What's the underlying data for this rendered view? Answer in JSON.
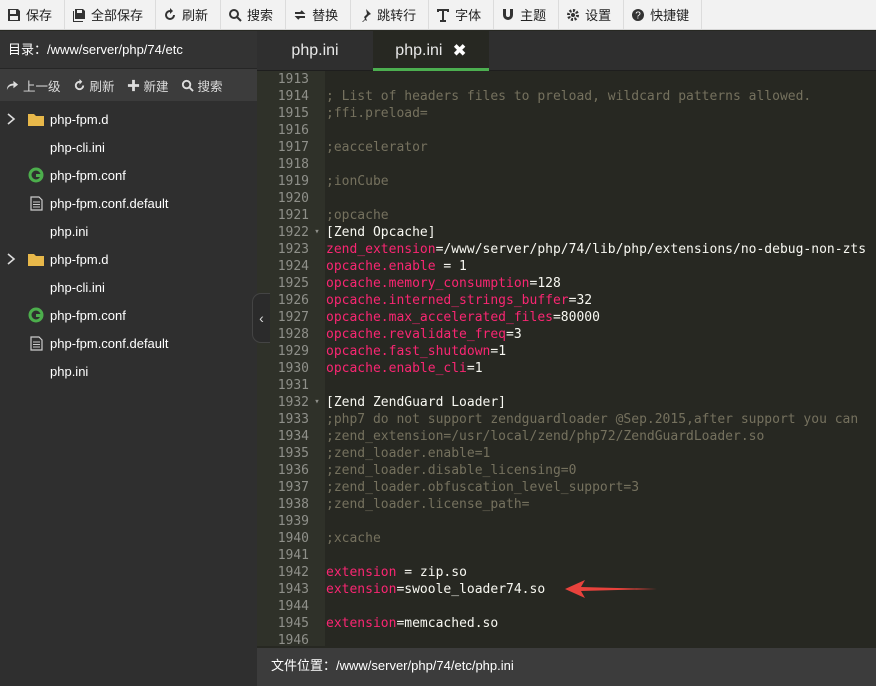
{
  "toolbar": {
    "buttons": [
      {
        "label": "保存",
        "icon": "save-icon"
      },
      {
        "label": "全部保存",
        "icon": "save-all-icon"
      },
      {
        "label": "刷新",
        "icon": "refresh-icon"
      },
      {
        "label": "搜索",
        "icon": "search-icon"
      },
      {
        "label": "替换",
        "icon": "replace-icon"
      },
      {
        "label": "跳转行",
        "icon": "pin-icon"
      },
      {
        "label": "字体",
        "icon": "font-icon"
      },
      {
        "label": "主题",
        "icon": "magnet-icon"
      },
      {
        "label": "设置",
        "icon": "gear-icon"
      },
      {
        "label": "快捷键",
        "icon": "help-icon"
      }
    ]
  },
  "sidebar": {
    "directory": "目录：/www/server/php/74/etc",
    "actions": [
      {
        "label": "上一级",
        "icon": "share-icon"
      },
      {
        "label": "刷新",
        "icon": "refresh-icon"
      },
      {
        "label": "新建",
        "icon": "plus-icon"
      },
      {
        "label": "搜索",
        "icon": "search-icon"
      }
    ],
    "files": [
      {
        "name": "php-fpm.d",
        "type": "folder"
      },
      {
        "name": "php-cli.ini",
        "type": "file"
      },
      {
        "name": "php-fpm.conf",
        "type": "conf"
      },
      {
        "name": "php-fpm.conf.default",
        "type": "doc"
      },
      {
        "name": "php.ini",
        "type": "file"
      },
      {
        "name": "php-fpm.d",
        "type": "folder"
      },
      {
        "name": "php-cli.ini",
        "type": "file"
      },
      {
        "name": "php-fpm.conf",
        "type": "conf"
      },
      {
        "name": "php-fpm.conf.default",
        "type": "doc"
      },
      {
        "name": "php.ini",
        "type": "file"
      }
    ]
  },
  "tabs": [
    {
      "label": "php.ini",
      "active": false
    },
    {
      "label": "php.ini",
      "active": true,
      "close": "✖"
    }
  ],
  "code_lines": [
    {
      "n": "1913",
      "fold": "",
      "parts": []
    },
    {
      "n": "1914",
      "fold": "",
      "parts": [
        {
          "t": "; List of headers files to preload, wildcard patterns allowed.",
          "c": "c"
        }
      ]
    },
    {
      "n": "1915",
      "fold": "",
      "parts": [
        {
          "t": ";ffi.preload=",
          "c": "c"
        }
      ]
    },
    {
      "n": "1916",
      "fold": "",
      "parts": []
    },
    {
      "n": "1917",
      "fold": "",
      "parts": [
        {
          "t": ";eaccelerator",
          "c": "c"
        }
      ]
    },
    {
      "n": "1918",
      "fold": "",
      "parts": []
    },
    {
      "n": "1919",
      "fold": "",
      "parts": [
        {
          "t": ";ionCube",
          "c": "c"
        }
      ]
    },
    {
      "n": "1920",
      "fold": "",
      "parts": []
    },
    {
      "n": "1921",
      "fold": "",
      "parts": [
        {
          "t": ";opcache",
          "c": "c"
        }
      ]
    },
    {
      "n": "1922",
      "fold": "▾",
      "parts": [
        {
          "t": "[Zend Opcache]",
          "c": "h"
        }
      ]
    },
    {
      "n": "1923",
      "fold": "",
      "parts": [
        {
          "t": "zend_extension",
          "c": "k"
        },
        {
          "t": "=/www/server/php/74/lib/php/extensions/no-debug-non-zts",
          "c": "h"
        }
      ]
    },
    {
      "n": "1924",
      "fold": "",
      "parts": [
        {
          "t": "opcache.enable",
          "c": "k"
        },
        {
          "t": " = 1",
          "c": "h"
        }
      ]
    },
    {
      "n": "1925",
      "fold": "",
      "parts": [
        {
          "t": "opcache.memory_consumption",
          "c": "k"
        },
        {
          "t": "=128",
          "c": "h"
        }
      ]
    },
    {
      "n": "1926",
      "fold": "",
      "parts": [
        {
          "t": "opcache.interned_strings_buffer",
          "c": "k"
        },
        {
          "t": "=32",
          "c": "h"
        }
      ]
    },
    {
      "n": "1927",
      "fold": "",
      "parts": [
        {
          "t": "opcache.max_accelerated_files",
          "c": "k"
        },
        {
          "t": "=80000",
          "c": "h"
        }
      ]
    },
    {
      "n": "1928",
      "fold": "",
      "parts": [
        {
          "t": "opcache.revalidate_freq",
          "c": "k"
        },
        {
          "t": "=3",
          "c": "h"
        }
      ]
    },
    {
      "n": "1929",
      "fold": "",
      "parts": [
        {
          "t": "opcache.fast_shutdown",
          "c": "k"
        },
        {
          "t": "=1",
          "c": "h"
        }
      ]
    },
    {
      "n": "1930",
      "fold": "",
      "parts": [
        {
          "t": "opcache.enable_cli",
          "c": "k"
        },
        {
          "t": "=1",
          "c": "h"
        }
      ]
    },
    {
      "n": "1931",
      "fold": "",
      "parts": []
    },
    {
      "n": "1932",
      "fold": "▾",
      "parts": [
        {
          "t": "[Zend ZendGuard Loader]",
          "c": "h"
        }
      ]
    },
    {
      "n": "1933",
      "fold": "",
      "parts": [
        {
          "t": ";php7 do not support zendguardloader @Sep.2015,after support you can",
          "c": "c"
        }
      ]
    },
    {
      "n": "1934",
      "fold": "",
      "parts": [
        {
          "t": ";zend_extension=/usr/local/zend/php72/ZendGuardLoader.so",
          "c": "c"
        }
      ]
    },
    {
      "n": "1935",
      "fold": "",
      "parts": [
        {
          "t": ";zend_loader.enable=1",
          "c": "c"
        }
      ]
    },
    {
      "n": "1936",
      "fold": "",
      "parts": [
        {
          "t": ";zend_loader.disable_licensing=0",
          "c": "c"
        }
      ]
    },
    {
      "n": "1937",
      "fold": "",
      "parts": [
        {
          "t": ";zend_loader.obfuscation_level_support=3",
          "c": "c"
        }
      ]
    },
    {
      "n": "1938",
      "fold": "",
      "parts": [
        {
          "t": ";zend_loader.license_path=",
          "c": "c"
        }
      ]
    },
    {
      "n": "1939",
      "fold": "",
      "parts": []
    },
    {
      "n": "1940",
      "fold": "",
      "parts": [
        {
          "t": ";xcache",
          "c": "c"
        }
      ]
    },
    {
      "n": "1941",
      "fold": "",
      "parts": []
    },
    {
      "n": "1942",
      "fold": "",
      "parts": [
        {
          "t": "extension",
          "c": "k"
        },
        {
          "t": " = zip.so",
          "c": "h"
        }
      ]
    },
    {
      "n": "1943",
      "fold": "",
      "parts": [
        {
          "t": "extension",
          "c": "k"
        },
        {
          "t": "=swoole_loader74.so",
          "c": "h"
        }
      ]
    },
    {
      "n": "1944",
      "fold": "",
      "parts": []
    },
    {
      "n": "1945",
      "fold": "",
      "parts": [
        {
          "t": "extension",
          "c": "k"
        },
        {
          "t": "=memcached.so",
          "c": "h"
        }
      ]
    },
    {
      "n": "1946",
      "fold": "",
      "parts": []
    }
  ],
  "status": "文件位置：/www/server/php/74/etc/php.ini",
  "collapse_glyph": "‹",
  "colors": {
    "accent": "#4caf50",
    "keyword": "#f92672",
    "comment": "#75715e",
    "arrow": "#e8423c"
  }
}
